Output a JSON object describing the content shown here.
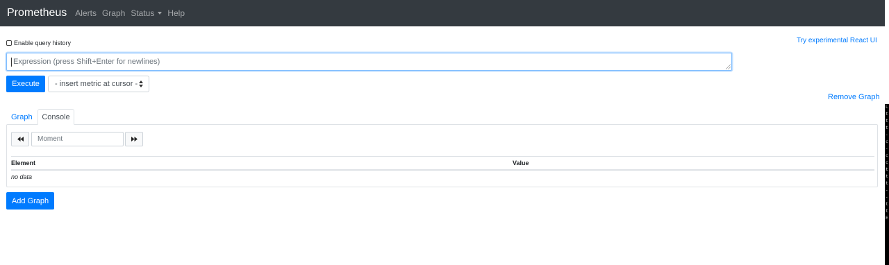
{
  "navbar": {
    "brand": "Prometheus",
    "links": [
      "Alerts",
      "Graph",
      "Status",
      "Help"
    ],
    "bg_color": "#343a40"
  },
  "query": {
    "history_label": "Enable query history",
    "history_checked": false,
    "react_link": "Try experimental React UI",
    "expression_value": "",
    "expression_placeholder": "Expression (press Shift+Enter for newlines)",
    "execute_label": "Execute",
    "metric_select": "- insert metric at cursor -",
    "remove_graph": "Remove Graph"
  },
  "tabs": [
    {
      "label": "Graph",
      "active": false
    },
    {
      "label": "Console",
      "active": true
    }
  ],
  "console": {
    "moment_placeholder": "Moment",
    "back_icon": "rewind-icon",
    "forward_icon": "fast-forward-icon",
    "columns": [
      "Element",
      "Value"
    ],
    "empty_text": "no data"
  },
  "add_graph": "Add Graph",
  "side_strip_chars": [
    "L",
    "t",
    "t",
    "t",
    "-",
    "c",
    "-",
    "c",
    "c",
    "t",
    "t",
    "t",
    "-",
    "-",
    "t",
    "t",
    "E"
  ],
  "colors": {
    "accent": "#007bff",
    "border": "#dee2e6"
  }
}
